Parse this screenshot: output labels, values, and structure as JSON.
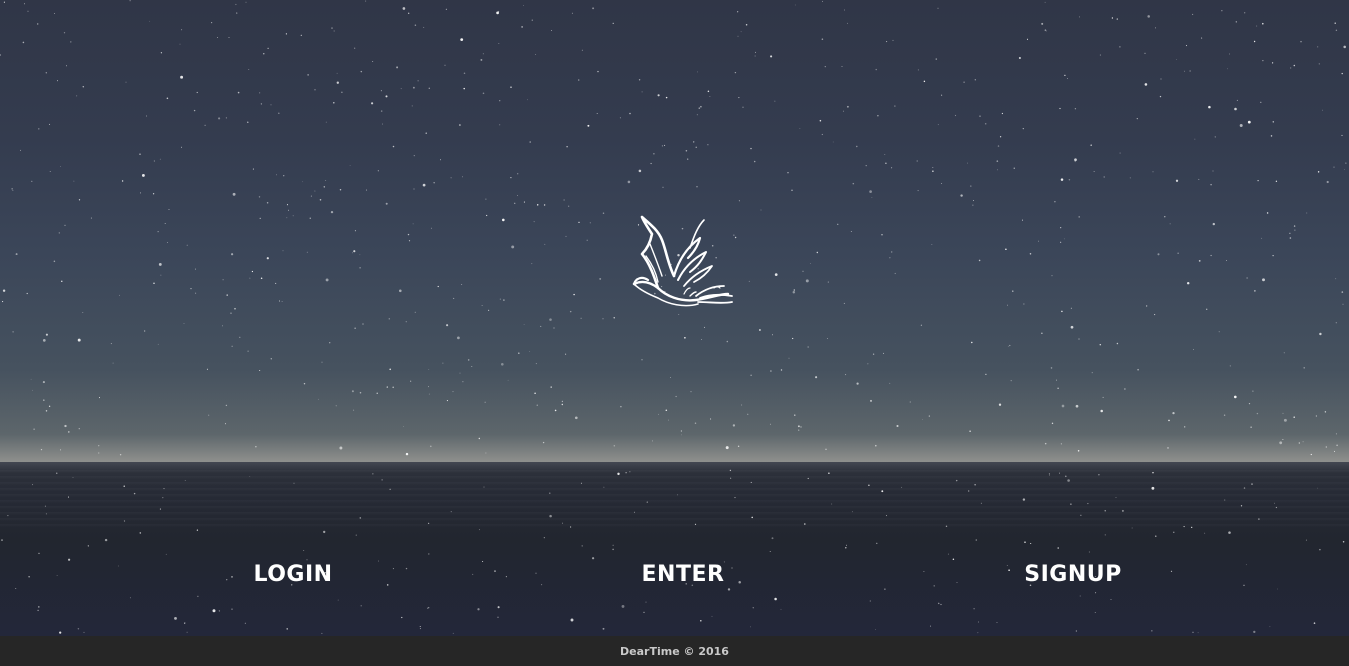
{
  "nav": {
    "login_label": "LOGIN",
    "enter_label": "ENTER",
    "signup_label": "SIGNUP"
  },
  "logo": {
    "icon": "dove-icon"
  },
  "footer": {
    "text": "DearTime © 2016"
  },
  "colors": {
    "sky_top": "#303647",
    "horizon": "#8f908d",
    "sea": "#23273a",
    "footer_bg": "#262626",
    "text": "#ffffff"
  }
}
